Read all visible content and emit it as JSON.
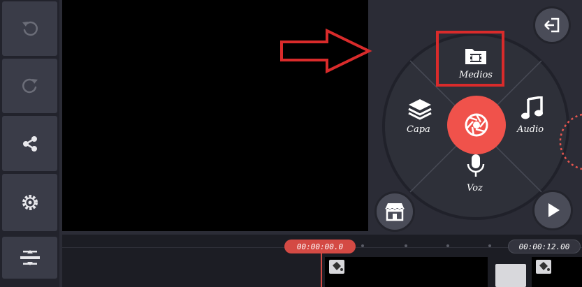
{
  "app": {
    "wheel_items": {
      "medios": "Medios",
      "capa": "Capa",
      "audio": "Audio",
      "voz": "Voz"
    },
    "timeline": {
      "current_time": "00:00:00.0",
      "total_time": "00:00:12.00"
    }
  },
  "colors": {
    "accent": "#f0524b",
    "annotation": "#d92b2b",
    "panel": "#2b2c36",
    "button": "#3a3c48"
  },
  "icons": {
    "undo": "undo-icon",
    "redo": "redo-icon",
    "share": "share-icon",
    "settings": "gear-icon",
    "adjust": "adjust-icon",
    "exit": "exit-icon",
    "store": "store-icon",
    "play": "play-icon",
    "camera": "camera-shutter-icon",
    "media": "film-folder-icon",
    "layer": "layers-icon",
    "audio": "music-note-icon",
    "voice": "microphone-icon"
  }
}
